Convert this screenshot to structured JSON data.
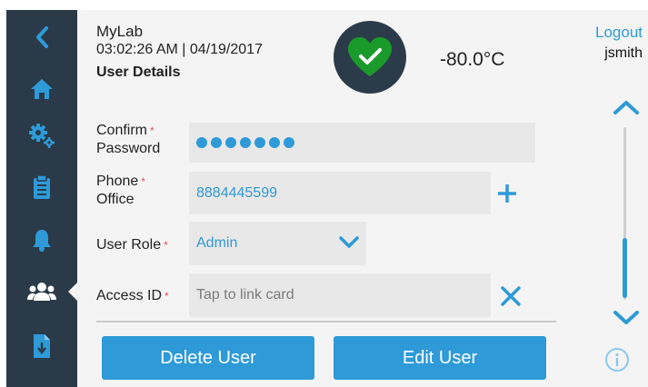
{
  "header": {
    "app_name": "MyLab",
    "timestamp": "03:02:26 AM | 04/19/2017",
    "page_title": "User Details",
    "temperature": "-80.0°C",
    "status_icon": "heart-check-icon",
    "logout_label": "Logout",
    "username": "jsmith"
  },
  "sidebar": {
    "items": [
      {
        "icon": "back-arrow-icon"
      },
      {
        "icon": "home-icon"
      },
      {
        "icon": "settings-gears-icon"
      },
      {
        "icon": "clipboard-icon"
      },
      {
        "icon": "bell-icon"
      },
      {
        "icon": "users-icon",
        "active": true
      },
      {
        "icon": "export-document-icon"
      }
    ]
  },
  "form": {
    "confirm_password": {
      "label_line1": "Confirm",
      "label_line2": "Password",
      "masked_length": 7
    },
    "phone": {
      "label_line1": "Phone",
      "label_line2": "Office",
      "value": "8884445599"
    },
    "user_role": {
      "label": "User Role",
      "value": "Admin"
    },
    "access_id": {
      "label": "Access ID",
      "placeholder": "Tap to link card"
    }
  },
  "actions": {
    "delete_label": "Delete User",
    "edit_label": "Edit User"
  },
  "colors": {
    "accent": "#2e9ad8",
    "sidebar": "#2a3a48",
    "required": "#e05060",
    "status_ok": "#1a9a2a"
  }
}
